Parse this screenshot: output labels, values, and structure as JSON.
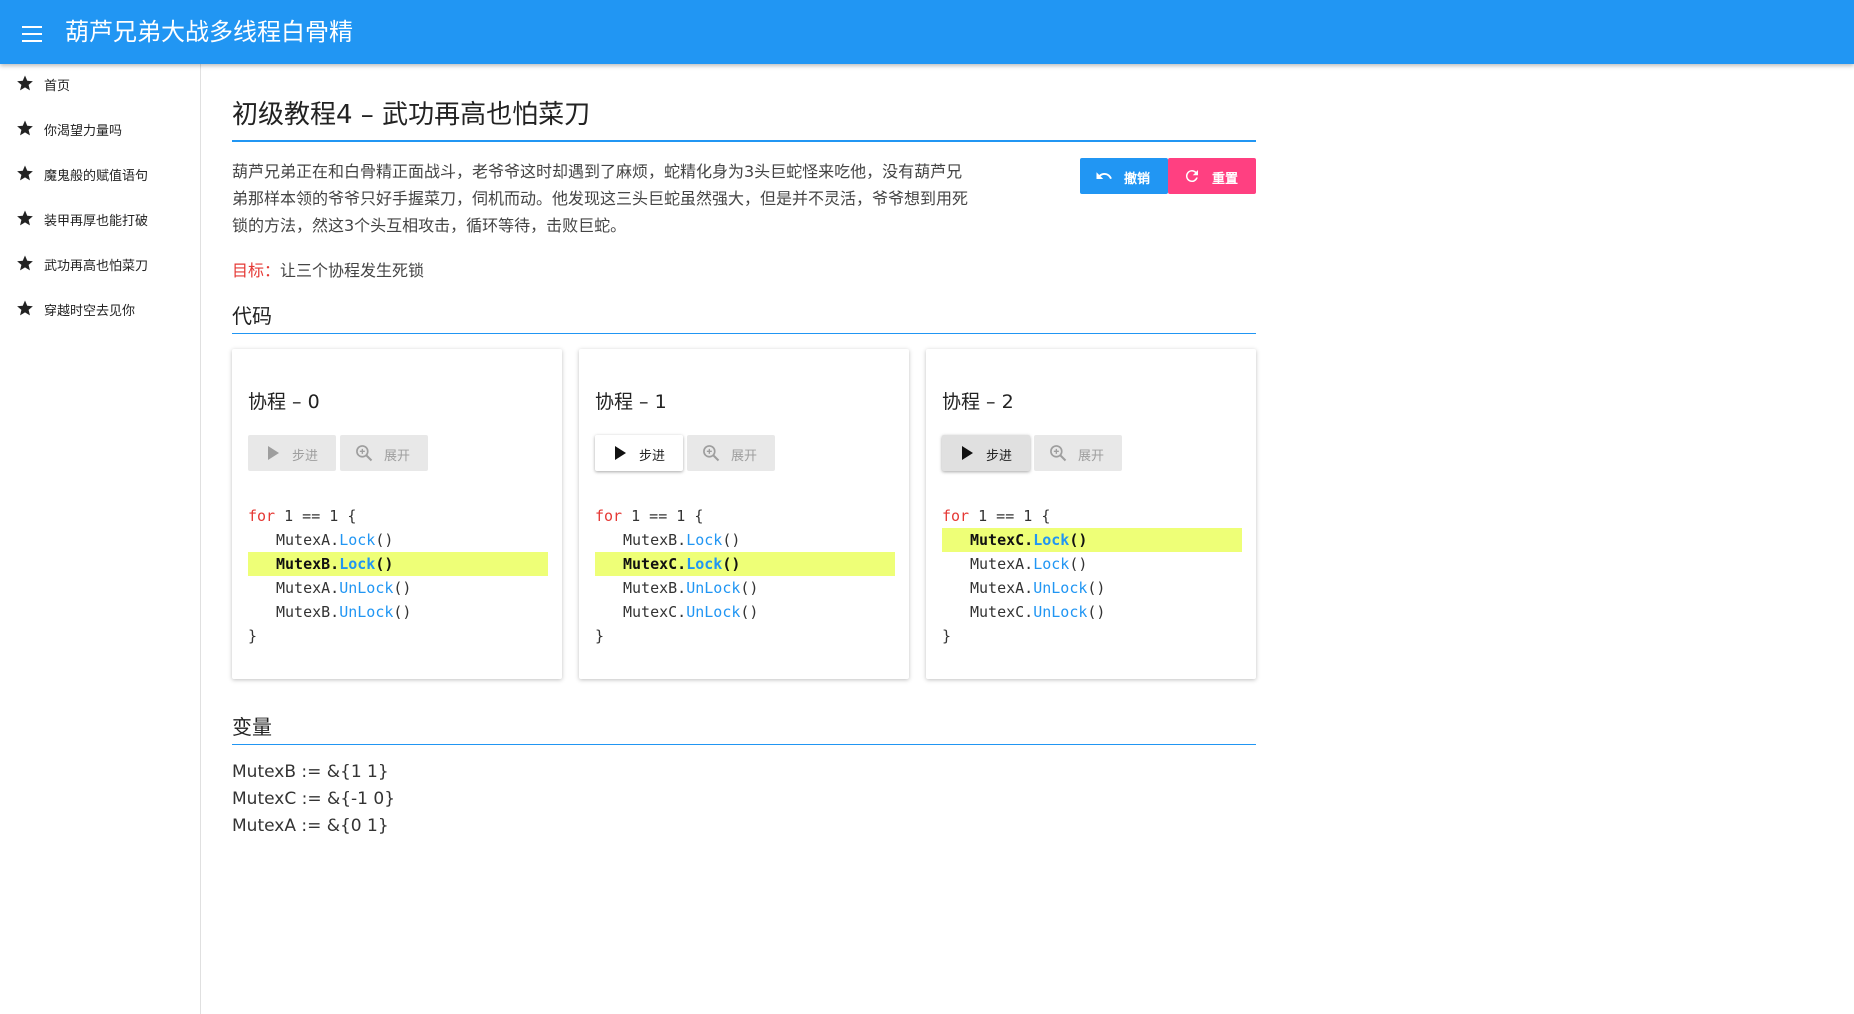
{
  "app": {
    "title": "葫芦兄弟大战多线程白骨精"
  },
  "sidebar": {
    "items": [
      {
        "label": "首页"
      },
      {
        "label": "你渴望力量吗"
      },
      {
        "label": "魔鬼般的赋值语句"
      },
      {
        "label": "装甲再厚也能打破"
      },
      {
        "label": "武功再高也怕菜刀"
      },
      {
        "label": "穿越时空去见你"
      }
    ]
  },
  "page": {
    "title": "初级教程4 – 武功再高也怕菜刀",
    "intro_lines": [
      "葫芦兄弟正在和白骨精正面战斗，老爷爷这时却遇到了麻烦，蛇精化身为3头巨蛇怪来吃他，没有葫芦兄",
      "弟那样本领的爷爷只好手握菜刀，伺机而动。他发现这三头巨蛇虽然强大，但是并不灵活，爷爷想到用死",
      "锁的方法，然这3个头互相攻击，循环等待，击败巨蛇。"
    ],
    "goal_label": "目标：",
    "goal_text": "让三个协程发生死锁"
  },
  "actions": {
    "undo_label": "撤销",
    "reset_label": "重置"
  },
  "sections": {
    "code_title": "代码",
    "vars_title": "变量"
  },
  "coroutines": [
    {
      "title": "协程 – 0",
      "step_label": "步进",
      "expand_label": "展开",
      "step_state": "disabled",
      "lines": [
        {
          "kw": "for",
          "text": " 1 == 1 {"
        },
        {
          "obj": "MutexA.",
          "fn": "Lock",
          "tail": "()"
        },
        {
          "obj": "MutexB.",
          "fn": "Lock",
          "tail": "()",
          "hl": true
        },
        {
          "obj": "MutexA.",
          "fn": "UnLock",
          "tail": "()"
        },
        {
          "obj": "MutexB.",
          "fn": "UnLock",
          "tail": "()"
        },
        {
          "text": "}"
        }
      ]
    },
    {
      "title": "协程 – 1",
      "step_label": "步进",
      "expand_label": "展开",
      "step_state": "active",
      "lines": [
        {
          "kw": "for",
          "text": " 1 == 1 {"
        },
        {
          "obj": "MutexB.",
          "fn": "Lock",
          "tail": "()"
        },
        {
          "obj": "MutexC.",
          "fn": "Lock",
          "tail": "()",
          "hl": true
        },
        {
          "obj": "MutexB.",
          "fn": "UnLock",
          "tail": "()"
        },
        {
          "obj": "MutexC.",
          "fn": "UnLock",
          "tail": "()"
        },
        {
          "text": "}"
        }
      ]
    },
    {
      "title": "协程 – 2",
      "step_label": "步进",
      "expand_label": "展开",
      "step_state": "pressed",
      "lines": [
        {
          "kw": "for",
          "text": " 1 == 1 {"
        },
        {
          "obj": "MutexC.",
          "fn": "Lock",
          "tail": "()",
          "hl": true
        },
        {
          "obj": "MutexA.",
          "fn": "Lock",
          "tail": "()"
        },
        {
          "obj": "MutexA.",
          "fn": "UnLock",
          "tail": "()"
        },
        {
          "obj": "MutexC.",
          "fn": "UnLock",
          "tail": "()"
        },
        {
          "text": "}"
        }
      ]
    }
  ],
  "variables": [
    "MutexB := &{1 1}",
    "MutexC := &{-1 0}",
    "MutexA := &{0 1}"
  ]
}
